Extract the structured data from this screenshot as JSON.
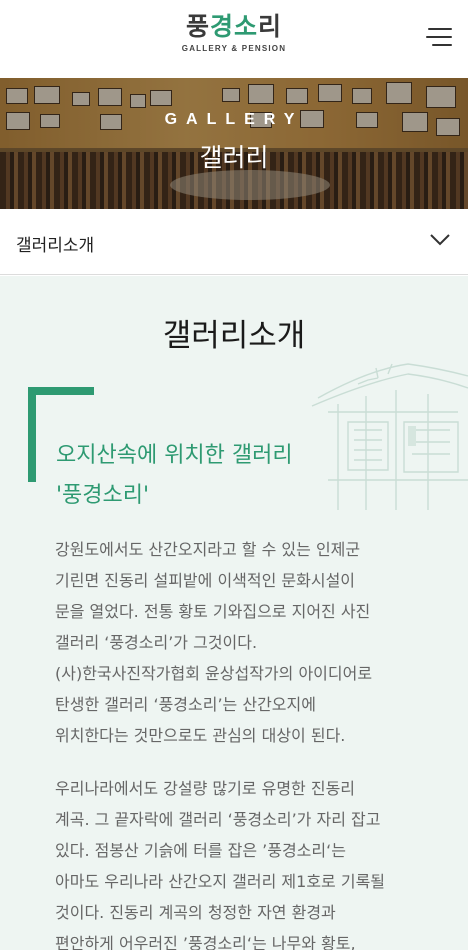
{
  "header": {
    "logo_part1": "풍",
    "logo_part2": "경",
    "logo_part3": "소",
    "logo_part4": "리",
    "logo_sub": "GALLERY & PENSION",
    "menu_icon": "hamburger-menu-icon"
  },
  "hero": {
    "title_en": "GALLERY",
    "title_ko": "갤러리"
  },
  "section_select": {
    "label": "갤러리소개",
    "icon": "chevron-down-icon"
  },
  "content": {
    "title": "갤러리소개",
    "headline_lines": [
      "오지산속에 위치한 갤러리",
      "'풍경소리'"
    ],
    "paragraph1_lines": [
      "강원도에서도 산간오지라고 할 수 있는 인제군",
      "기린면 진동리 설피밭에 이색적인 문화시설이",
      "문을 열었다. 전통 황토 기와집으로 지어진 사진",
      "갤러리 ‘풍경소리’가 그것이다.",
      "(사)한국사진작가협회 윤상섭작가의 아이디어로",
      "탄생한 갤러리 ‘풍경소리’는 산간오지에",
      "위치한다는 것만으로도 관심의 대상이 된다."
    ],
    "paragraph2_lines": [
      "우리나라에서도 강설량 많기로 유명한 진동리",
      "계곡. 그 끝자락에 갤러리 ‘풍경소리’가 자리 잡고",
      "있다. 점봉산 기슭에 터를 잡은 ’풍경소리‘는",
      "아마도 우리나라 산간오지 갤러리 제1호로 기록될",
      "것이다. 진동리 계곡의 청정한 자연 환경과",
      "편안하게 어우러진 ’풍경소리‘는 나무와 황토,"
    ]
  },
  "colors": {
    "accent_green": "#2e9a72",
    "content_bg": "#eef5f2",
    "body_text": "#666666"
  }
}
